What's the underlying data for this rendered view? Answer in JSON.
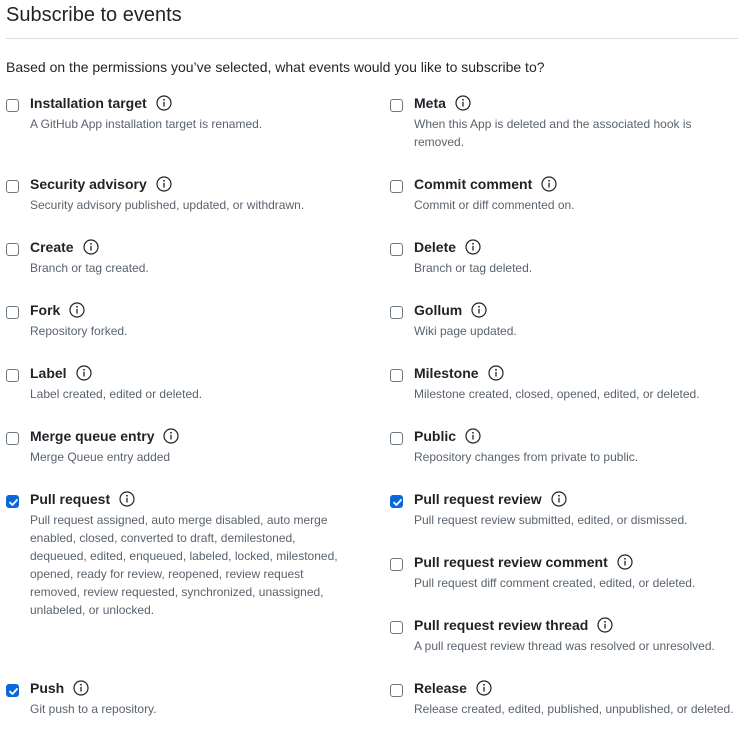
{
  "title": "Subscribe to events",
  "intro": "Based on the permissions you’ve selected, what events would you like to subscribe to?",
  "left": [
    {
      "label": "Installation target",
      "description": "A GitHub App installation target is renamed.",
      "checked": false
    },
    {
      "label": "Security advisory",
      "description": "Security advisory published, updated, or withdrawn.",
      "checked": false
    },
    {
      "label": "Create",
      "description": "Branch or tag created.",
      "checked": false
    },
    {
      "label": "Fork",
      "description": "Repository forked.",
      "checked": false
    },
    {
      "label": "Label",
      "description": "Label created, edited or deleted.",
      "checked": false
    },
    {
      "label": "Merge queue entry",
      "description": "Merge Queue entry added",
      "checked": false
    },
    {
      "label": "Pull request",
      "description": "Pull request assigned, auto merge disabled, auto merge enabled, closed, converted to draft, demilestoned, dequeued, edited, enqueued, labeled, locked, milestoned, opened, ready for review, reopened, review request removed, review requested, synchronized, unassigned, unlabeled, or unlocked.",
      "checked": true
    },
    {
      "label": "Push",
      "description": "Git push to a repository.",
      "checked": true
    }
  ],
  "right": [
    {
      "label": "Meta",
      "description": "When this App is deleted and the associated hook is removed.",
      "checked": false
    },
    {
      "label": "Commit comment",
      "description": "Commit or diff commented on.",
      "checked": false
    },
    {
      "label": "Delete",
      "description": "Branch or tag deleted.",
      "checked": false
    },
    {
      "label": "Gollum",
      "description": "Wiki page updated.",
      "checked": false
    },
    {
      "label": "Milestone",
      "description": "Milestone created, closed, opened, edited, or deleted.",
      "checked": false
    },
    {
      "label": "Public",
      "description": "Repository changes from private to public.",
      "checked": false
    },
    {
      "label": "Pull request review",
      "description": "Pull request review submitted, edited, or dismissed.",
      "checked": true
    },
    {
      "label": "Pull request review comment",
      "description": "Pull request diff comment created, edited, or deleted.",
      "checked": false
    },
    {
      "label": "Pull request review thread",
      "description": "A pull request review thread was resolved or unresolved.",
      "checked": false
    },
    {
      "label": "Release",
      "description": "Release created, edited, published, unpublished, or deleted.",
      "checked": false
    }
  ],
  "colors": {
    "accent": "#0969da",
    "text": "#1f2328",
    "muted": "#59636e"
  }
}
